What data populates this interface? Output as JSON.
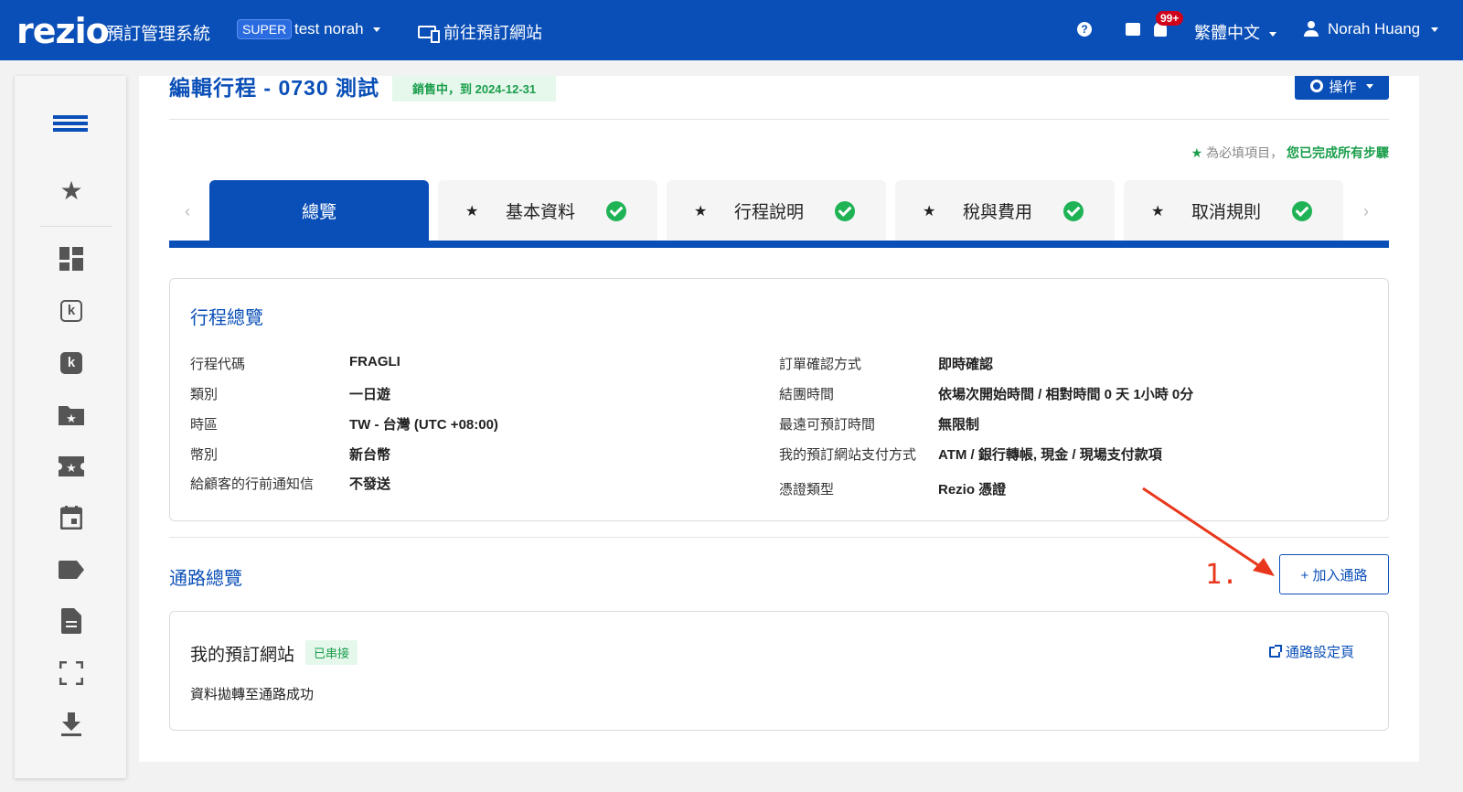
{
  "header": {
    "logo": "rezio",
    "system_name": "預訂管理系統",
    "super_badge": "SUPER",
    "account": "test norah",
    "goto_label": "前往預訂網站",
    "help_icon": "?",
    "notification_count": "99+",
    "language": "繁體中文",
    "user_name": "Norah Huang"
  },
  "sidebar": {
    "icons": [
      "menu-icon",
      "star-icon",
      "dashboard-icon",
      "k-outline-icon",
      "k-filled-icon",
      "folder-star-icon",
      "ticket-star-icon",
      "calendar-icon",
      "tag-icon",
      "document-icon",
      "fullscreen-icon",
      "download-icon"
    ]
  },
  "page": {
    "title": "編輯行程 - 0730 測試",
    "status_badge": "銷售中，到 2024-12-31",
    "ops_label": "操作",
    "required_star": "★",
    "required_note": "為必填項目，",
    "completed_note": "您已完成所有步驟"
  },
  "tabs": [
    {
      "label": "總覽",
      "active": true,
      "star": "",
      "completed": false
    },
    {
      "label": "基本資料",
      "active": false,
      "star": "★",
      "completed": true
    },
    {
      "label": "行程說明",
      "active": false,
      "star": "★",
      "completed": true
    },
    {
      "label": "稅與費用",
      "active": false,
      "star": "★",
      "completed": true
    },
    {
      "label": "取消規則",
      "active": false,
      "star": "★",
      "completed": true
    }
  ],
  "tab_nav": {
    "prev": "‹",
    "next": "›"
  },
  "overview": {
    "title": "行程總覽",
    "left": [
      {
        "label": "行程代碼",
        "value": "FRAGLI"
      },
      {
        "label": "類別",
        "value": "一日遊"
      },
      {
        "label": "時區",
        "value": "TW - 台灣 (UTC +08:00)"
      },
      {
        "label": "幣別",
        "value": "新台幣"
      },
      {
        "label": "給顧客的行前通知信",
        "value": "不發送"
      }
    ],
    "right": [
      {
        "label": "訂單確認方式",
        "value": "即時確認"
      },
      {
        "label": "結團時間",
        "value": "依場次開始時間 / 相對時間 0 天 1小時 0分"
      },
      {
        "label": "最遠可預訂時間",
        "value": "無限制"
      },
      {
        "label": "我的預訂網站支付方式",
        "value": "ATM / 銀行轉帳, 現金 / 現場支付款項"
      },
      {
        "label": "憑證類型",
        "value": "Rezio 憑證"
      }
    ]
  },
  "channels": {
    "title": "通路總覽",
    "add_button": "+ 加入通路",
    "annotation": "1.",
    "items": [
      {
        "name": "我的預訂網站",
        "status": "已串接",
        "link": "通路設定頁",
        "message": "資料拋轉至通路成功"
      }
    ]
  },
  "colors": {
    "brand": "#0a4fb7",
    "success": "#1fb356",
    "annotation": "#e8371c"
  }
}
